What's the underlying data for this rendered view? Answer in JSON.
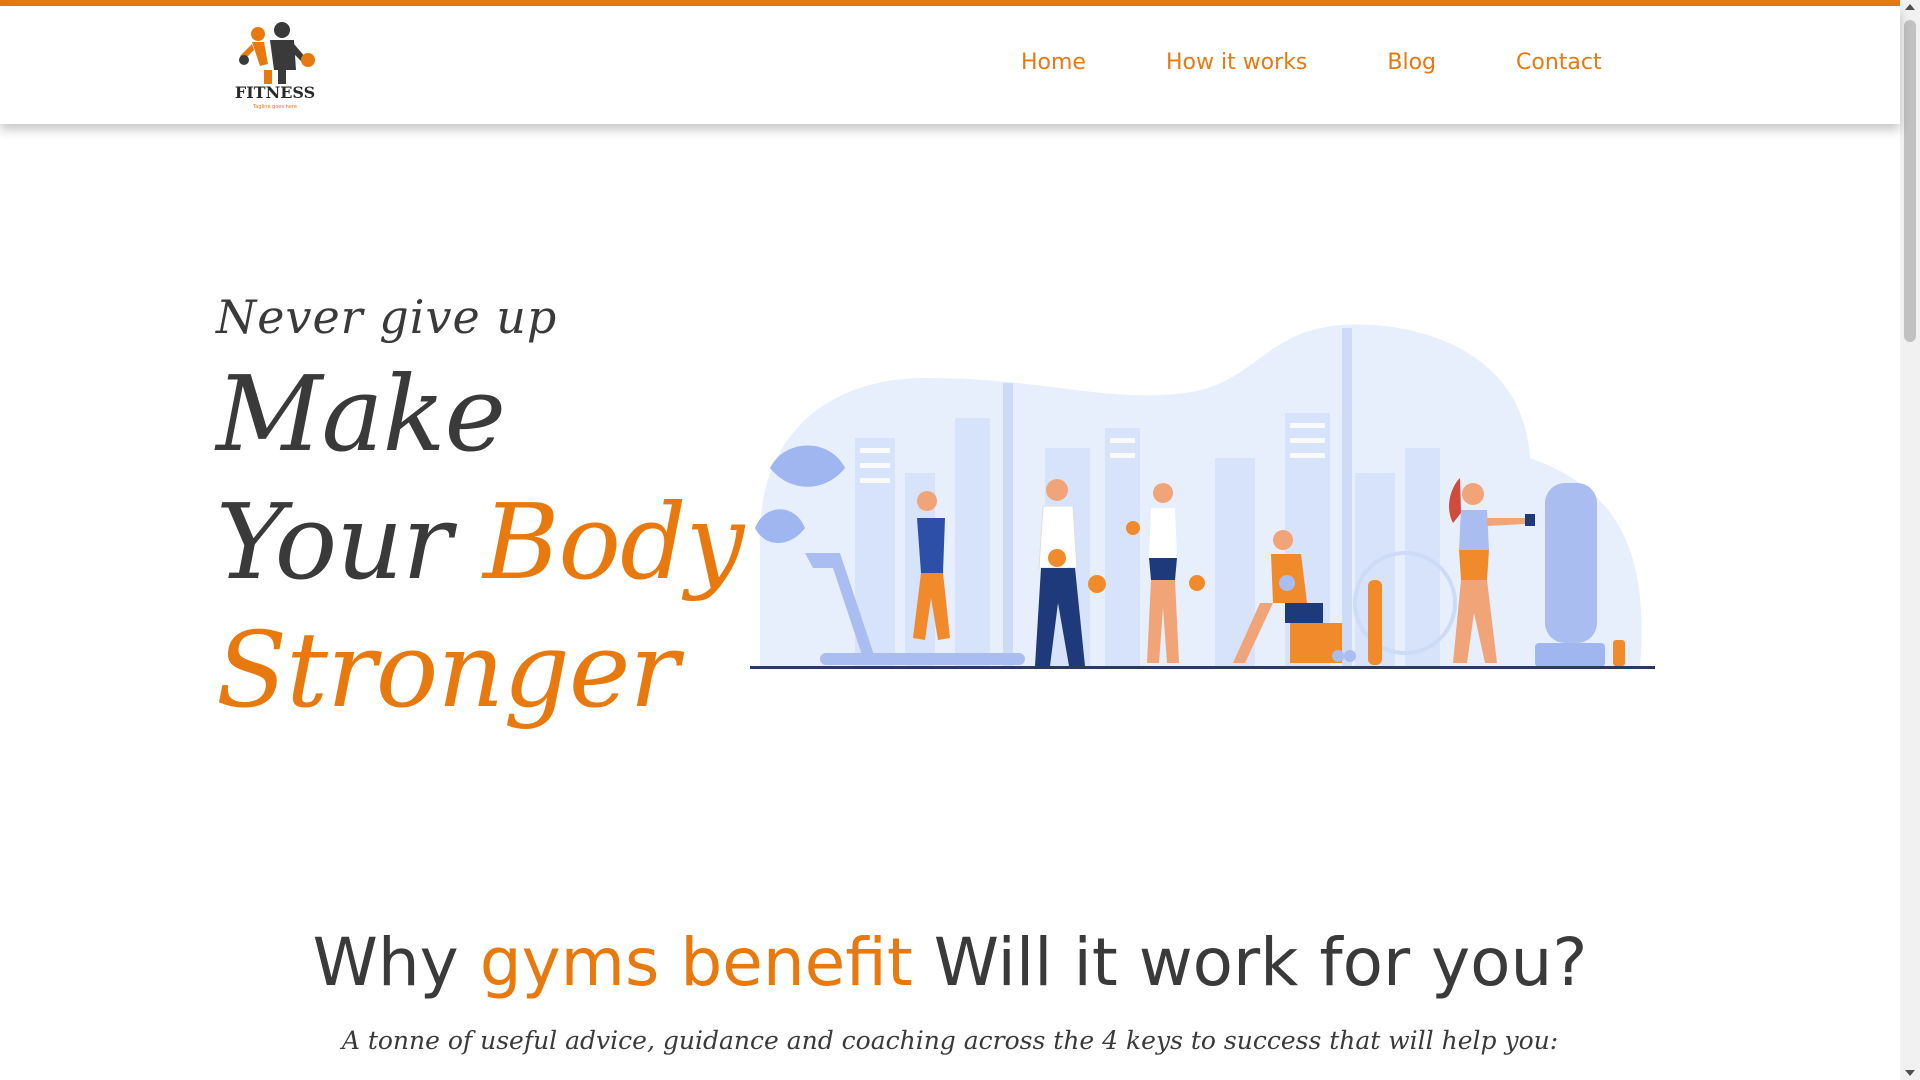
{
  "brand": {
    "logo_text": "FITNESS",
    "logo_tagline": "Tagline goes here",
    "accent_color": "#e8790f",
    "text_color": "#3a3a3a"
  },
  "nav": {
    "items": [
      {
        "label": "Home"
      },
      {
        "label": "How it works"
      },
      {
        "label": "Blog"
      },
      {
        "label": "Contact"
      }
    ]
  },
  "hero": {
    "tagline": "Never give up",
    "title_line1": "Make",
    "title_line2_plain": "Your ",
    "title_line2_accent": "Body",
    "title_line3_accent": "Stronger",
    "illustration": "gym-people-illustration"
  },
  "benefits": {
    "title_plain1": "Why ",
    "title_accent": "gyms benefit",
    "title_plain2": " Will it work for you?",
    "subtitle": "A tonne of useful advice, guidance and coaching across the 4 keys to success that will help you:"
  }
}
